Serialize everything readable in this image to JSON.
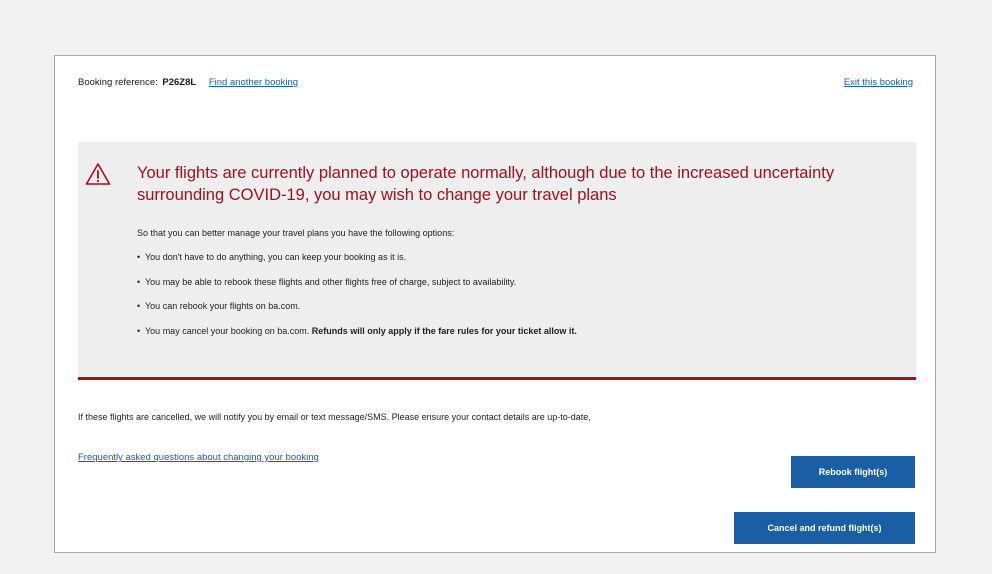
{
  "header": {
    "booking_ref_label": "Booking reference:",
    "booking_ref_code": "P26Z8L",
    "find_another_link": "Find another booking",
    "exit_link": "Exit this booking"
  },
  "notice": {
    "icon": "warning-triangle-icon",
    "headline": "Your flights are currently planned to operate normally, although due to the increased uncertainty surrounding COVID-19, you may wish to change your travel plans",
    "intro": "So that you can better manage your travel plans you have the following options:",
    "options": [
      "You don't have to do anything, you can keep your booking as it is.",
      "You may be able to rebook these flights and other flights free of charge, subject to availability.",
      "You can rebook your flights on ba.com."
    ],
    "last_option_text": "You may cancel your booking on ba.com.",
    "last_option_bold": "Refunds will only apply if the fare rules for your ticket allow it."
  },
  "footer": {
    "contact_note": "If these flights are cancelled, we will notify you by email or text message/SMS. Please ensure your contact details are up-to-date,",
    "faq_link": "Frequently asked questions about changing your booking",
    "rebook_button": "Rebook flight(s)",
    "cancel_button": "Cancel and refund flight(s)"
  },
  "colors": {
    "accent_red": "#a50e1d",
    "link_blue": "#1a5ea6",
    "button_blue": "#1a5ea6"
  }
}
